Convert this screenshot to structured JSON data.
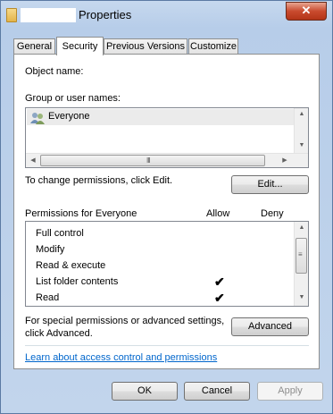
{
  "window": {
    "title": "Properties",
    "close_label": "✕"
  },
  "tabs": [
    {
      "label": "General",
      "active": false
    },
    {
      "label": "Security",
      "active": true
    },
    {
      "label": "Previous Versions",
      "active": false
    },
    {
      "label": "Customize",
      "active": false
    }
  ],
  "security": {
    "object_name_label": "Object name:",
    "groups_label": "Group or user names:",
    "users": [
      {
        "name": "Everyone",
        "icon": "users-icon",
        "selected": true
      }
    ],
    "change_text": "To change permissions, click Edit.",
    "edit_button": "Edit...",
    "permissions_header": "Permissions for Everyone",
    "allow_header": "Allow",
    "deny_header": "Deny",
    "permissions": [
      {
        "name": "Full control",
        "allow": false,
        "deny": false
      },
      {
        "name": "Modify",
        "allow": false,
        "deny": false
      },
      {
        "name": "Read & execute",
        "allow": false,
        "deny": false
      },
      {
        "name": "List folder contents",
        "allow": true,
        "deny": false
      },
      {
        "name": "Read",
        "allow": true,
        "deny": false
      }
    ],
    "special_text_line1": "For special permissions or advanced settings,",
    "special_text_line2": "click Advanced.",
    "advanced_button": "Advanced",
    "learn_link": "Learn about access control and permissions"
  },
  "footer": {
    "ok": "OK",
    "cancel": "Cancel",
    "apply": "Apply"
  },
  "scroll_glyphs": {
    "up": "▲",
    "down": "▼",
    "left": "◀",
    "right": "▶",
    "grip_h": "III",
    "grip_v": "≡"
  },
  "check_glyph": "✔"
}
